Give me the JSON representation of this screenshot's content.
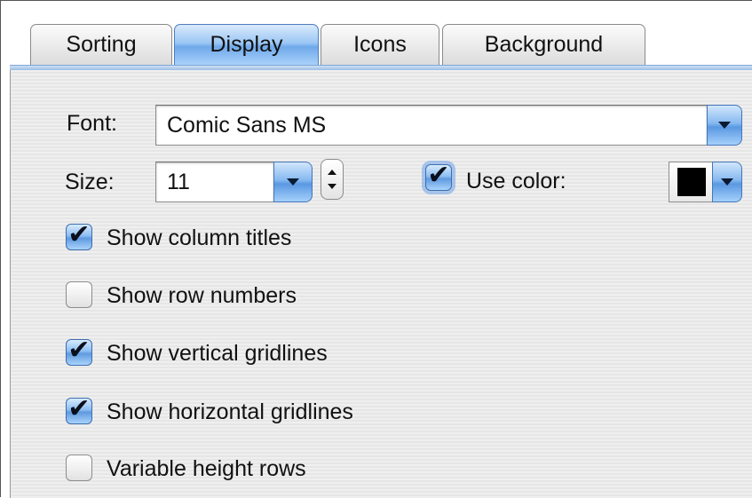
{
  "tabs": [
    {
      "label": "Sorting",
      "active": false
    },
    {
      "label": "Display",
      "active": true
    },
    {
      "label": "Icons",
      "active": false
    },
    {
      "label": "Background",
      "active": false
    }
  ],
  "font": {
    "label": "Font:",
    "value": "Comic Sans MS"
  },
  "size": {
    "label": "Size:",
    "value": "11"
  },
  "use_color": {
    "label": "Use color:",
    "checked": true,
    "swatch_color": "#000000"
  },
  "options": [
    {
      "label": "Show column titles",
      "checked": true
    },
    {
      "label": "Show row numbers",
      "checked": false
    },
    {
      "label": "Show vertical gridlines",
      "checked": true
    },
    {
      "label": "Show horizontal gridlines",
      "checked": true
    },
    {
      "label": "Variable height rows",
      "checked": false
    }
  ],
  "colors": {
    "accent": "#6fa9ea",
    "checkmark": "#0a0f1c"
  },
  "icons": {
    "dropdown": "chevron-down-icon",
    "stepper": "stepper-arrows-icon",
    "check": "checkmark-icon"
  }
}
